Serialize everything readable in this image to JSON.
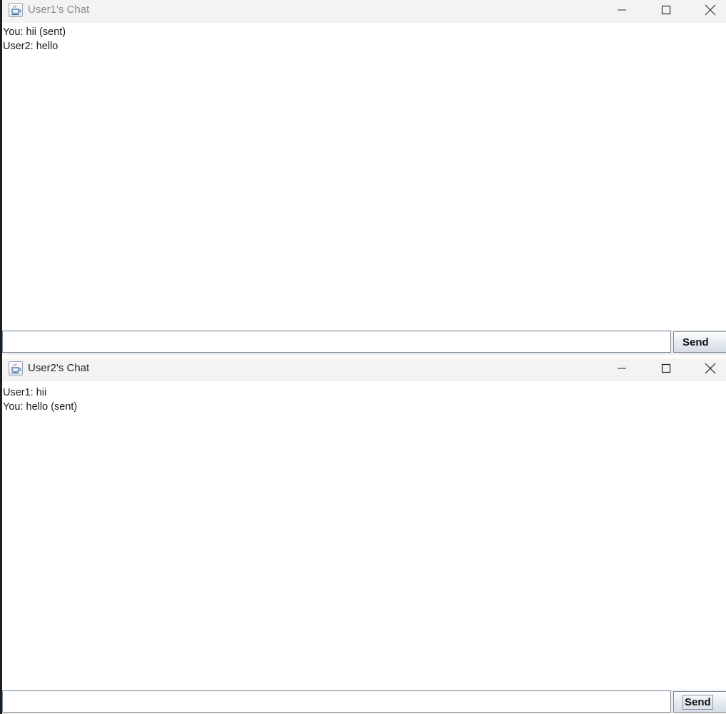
{
  "windows": [
    {
      "title": "User1's Chat",
      "icon": "java-app-icon",
      "messages": [
        "You: hii (sent)",
        "User2: hello"
      ],
      "input_value": "",
      "send_label": "Send"
    },
    {
      "title": "User2's Chat",
      "icon": "java-app-icon",
      "messages": [
        "User1: hii",
        "You: hello (sent)"
      ],
      "input_value": "",
      "send_label": "Send"
    }
  ],
  "icons": {
    "minimize": "minimize-icon",
    "maximize": "maximize-icon",
    "close": "close-icon"
  }
}
